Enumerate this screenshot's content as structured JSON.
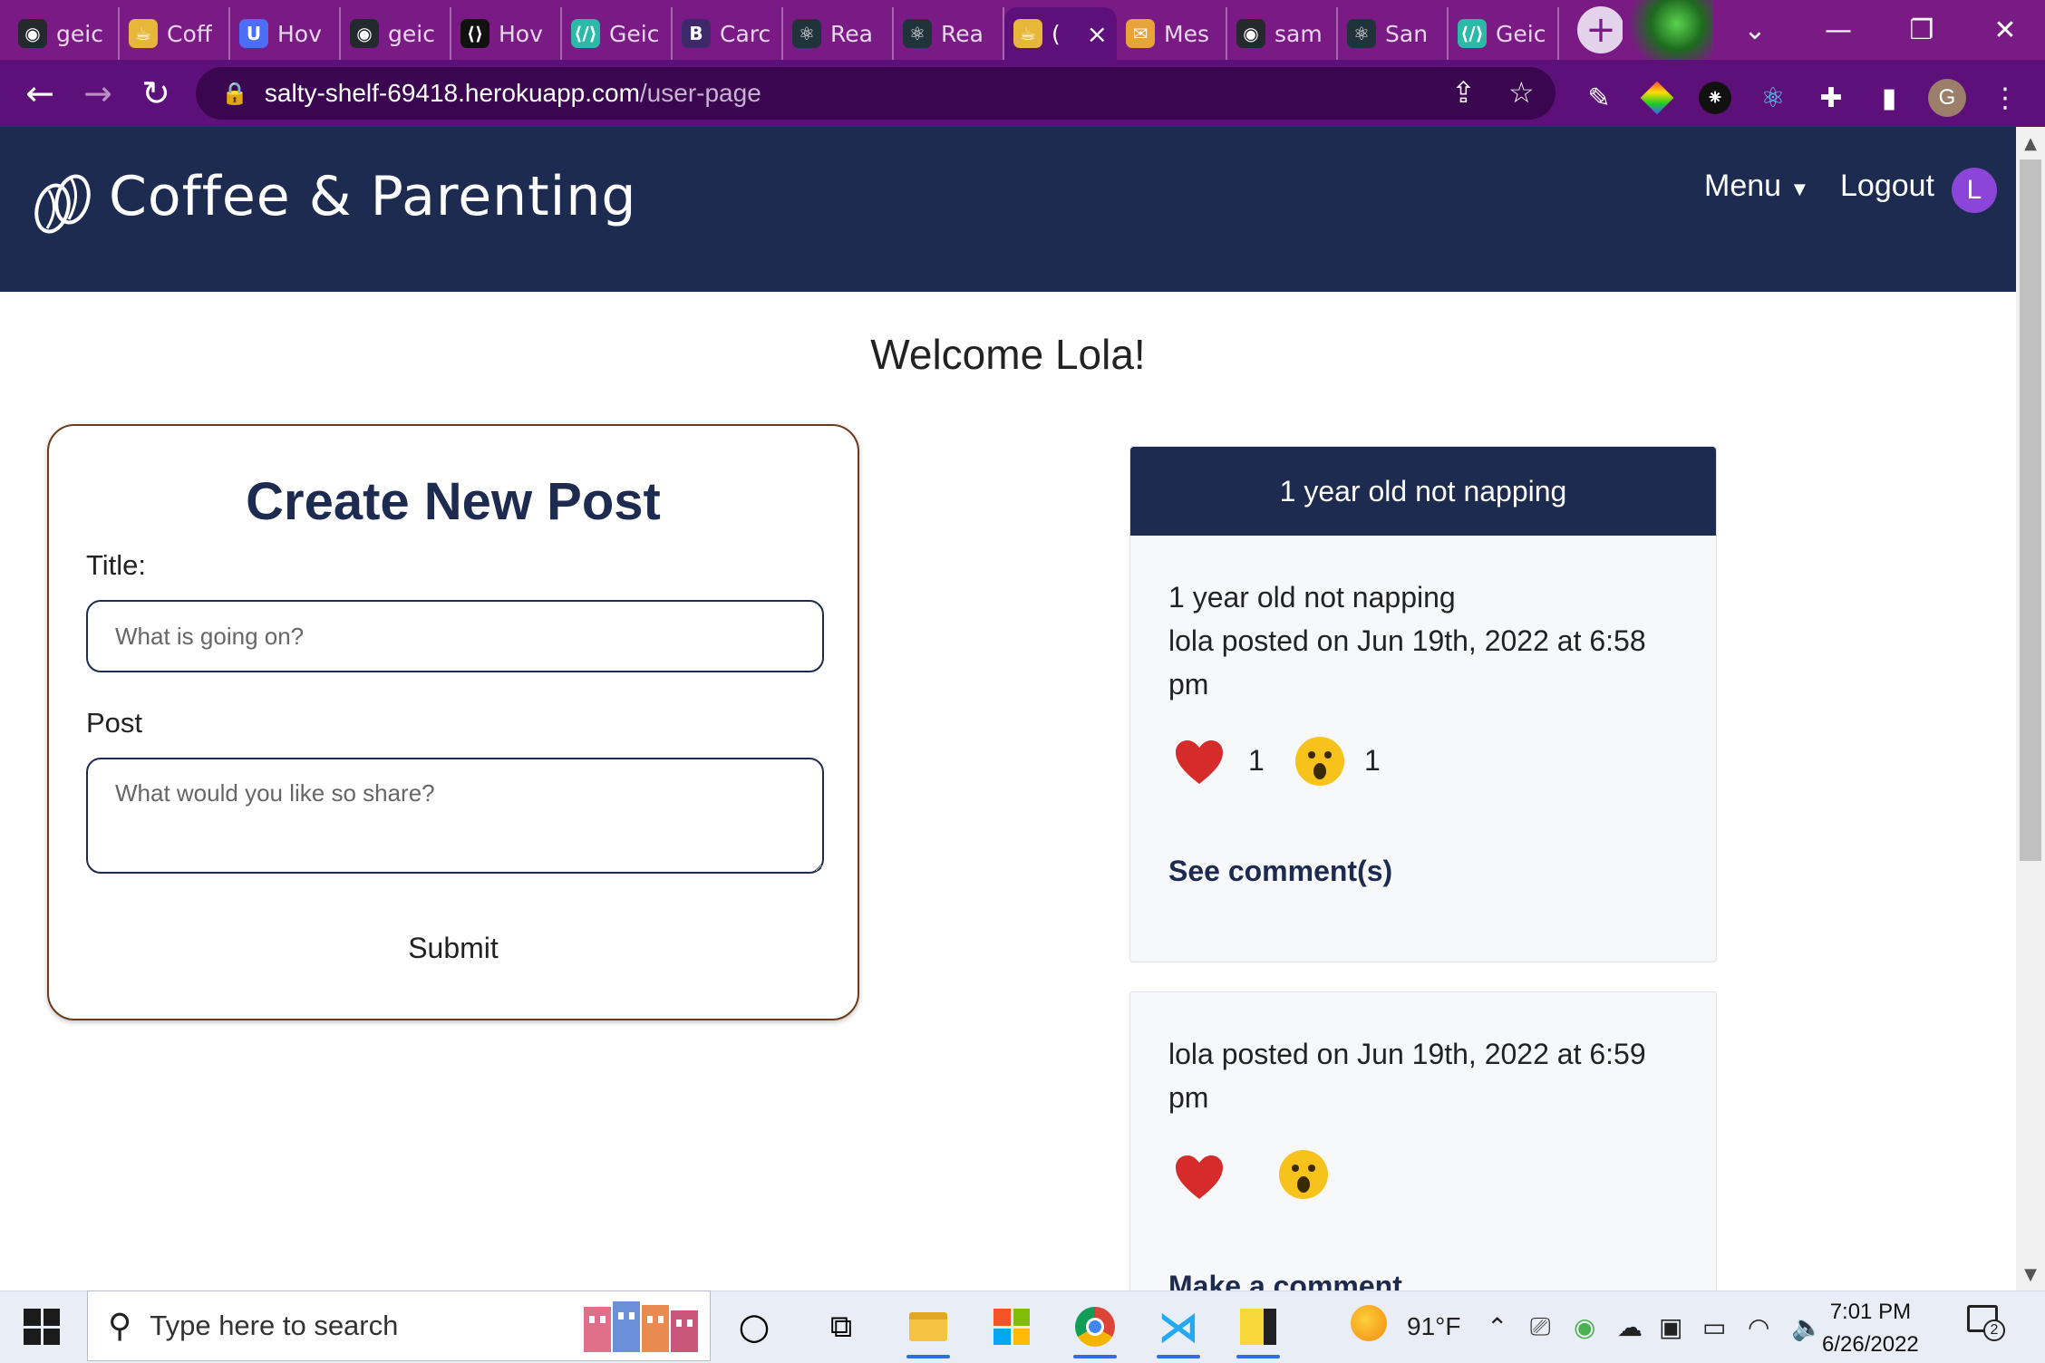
{
  "browser": {
    "tabs": [
      {
        "label": "geic",
        "icon": "github-icon"
      },
      {
        "label": "Coff",
        "icon": "coffee-cup-icon"
      },
      {
        "label": "Hov",
        "icon": "u-logo-icon"
      },
      {
        "label": "geic",
        "icon": "github-icon"
      },
      {
        "label": "Hov",
        "icon": "code-logo-icon"
      },
      {
        "label": "Geic",
        "icon": "code-editor-icon"
      },
      {
        "label": "Carc",
        "icon": "bootstrap-icon"
      },
      {
        "label": "Rea",
        "icon": "react-icon"
      },
      {
        "label": "Rea",
        "icon": "react-icon"
      },
      {
        "label": "(",
        "icon": "coffee-cup-icon",
        "active": true
      },
      {
        "label": "Mes",
        "icon": "message-icon"
      },
      {
        "label": "sam",
        "icon": "github-icon"
      },
      {
        "label": "San",
        "icon": "react-icon"
      },
      {
        "label": "Geic",
        "icon": "code-editor-icon"
      }
    ],
    "active_tab_close": "×",
    "new_tab": "+",
    "url_host": "salty-shelf-69418.herokuapp.com",
    "url_path": "/user-page",
    "profile_initial": "G"
  },
  "site": {
    "brand": "Coffee & Parenting",
    "menu_label": "Menu",
    "logout_label": "Logout",
    "avatar_initial": "L"
  },
  "page": {
    "welcome": "Welcome Lola!",
    "form": {
      "heading": "Create New Post",
      "title_label": "Title:",
      "title_placeholder": "What is going on?",
      "post_label": "Post",
      "post_placeholder": "What would you like so share?",
      "submit_label": "Submit"
    },
    "posts": [
      {
        "header": "1 year old not napping",
        "title": "1 year old not napping",
        "meta": "lola  posted on  Jun 19th, 2022 at 6:58 pm",
        "heart_count": "1",
        "wow_count": "1",
        "link": "See comment(s)"
      },
      {
        "meta": "lola  posted on  Jun 19th, 2022 at 6:59 pm",
        "link": "Make a comment"
      }
    ]
  },
  "taskbar": {
    "search_placeholder": "Type here to search",
    "weather": "91°F",
    "time": "7:01 PM",
    "date": "6/26/2022",
    "notification_count": "2"
  },
  "colors": {
    "tab_strip": "#7a1a85",
    "toolbar": "#5d1079",
    "navbar": "#1c2b4f",
    "avatar": "#8b45d9",
    "heart": "#d62b2b",
    "wow": "#f7c21b"
  }
}
